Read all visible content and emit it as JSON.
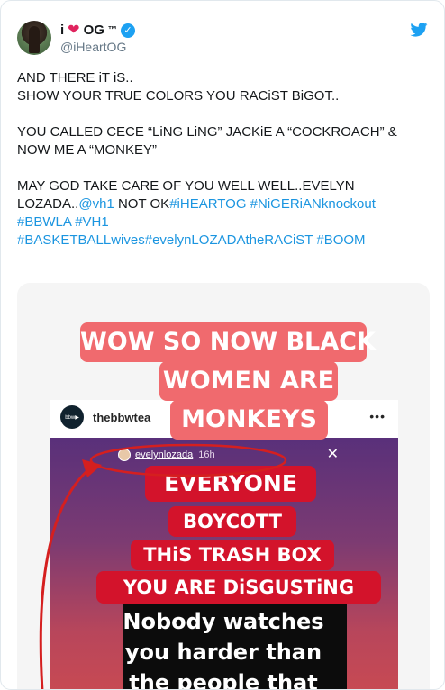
{
  "tweet": {
    "display_name": "i",
    "display_name_suffix": "OG",
    "tm": "™",
    "handle": "@iHeartOG",
    "paragraphs": [
      [
        "AND THERE iT iS..",
        "SHOW YOUR TRUE COLORS YOU RACiST BiGOT.."
      ],
      [
        "YOU CALLED CECE “LiNG LiNG” JACKiE A “COCKROACH” & NOW ME A “MONKEY”"
      ]
    ],
    "p3_text": "MAY GOD TAKE CARE OF YOU WELL WELL..EVELYN LOZADA..",
    "p3_mention": "@vh1",
    "p3_text2": " NOT OK",
    "p3_tag1": "#iHEARTOG",
    "p3_tag2": "#NiGERiANknockout",
    "p3_tag3": "#BBWLA",
    "p3_tag4": "#VH1",
    "p3_tag5": "#BASKETBALLwives",
    "p3_tag6": "#evelynLOZADAtheRACiST",
    "p3_tag7": "#BOOM"
  },
  "media": {
    "headline_1": "WOW SO NOW BLACK",
    "headline_2": "WOMEN ARE",
    "headline_3": "MONKEYS",
    "post_username": "thebbwtea",
    "post_avatar_text": "bbw▶",
    "post_menu": "•••",
    "story_username": "evelynlozada",
    "story_time": "16h",
    "story_close": "✕",
    "caption_1": "EVERYONE",
    "caption_2": "BOYCOTT",
    "caption_3": "THiS TRASH BOX",
    "caption_4": "YOU ARE DiSGUSTiNG",
    "body_1": "Nobody watches",
    "body_2": "you harder than",
    "body_3": "the people that"
  },
  "icons": {
    "heart": "heart-icon",
    "verified": "verified-badge-icon",
    "bird": "twitter-bird-icon",
    "close": "close-icon",
    "more": "more-icon"
  },
  "colors": {
    "link": "#1b95e0",
    "heart": "#e0245e",
    "verified": "#1da1f2",
    "tag_pink": "#f06a6e",
    "tag_red": "#d3132b"
  }
}
